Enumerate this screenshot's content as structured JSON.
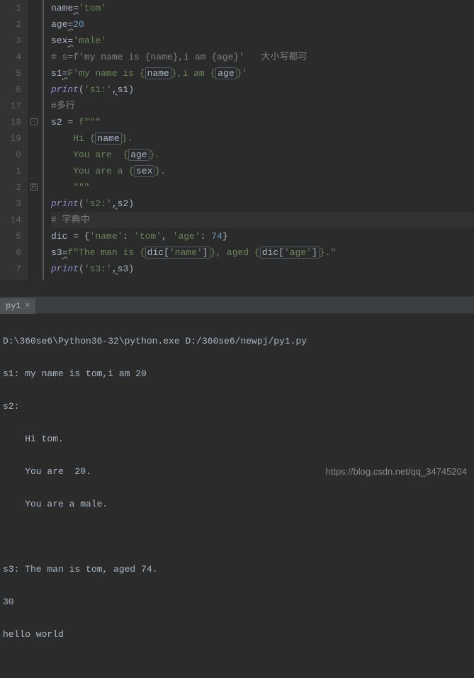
{
  "gutter": [
    "1",
    "2",
    "3",
    "4",
    "5",
    "6",
    "17",
    "18",
    "19",
    "0",
    "1",
    "2",
    "3",
    "14",
    "5",
    "6",
    "7"
  ],
  "code": {
    "l1": {
      "a": "name",
      "b": "=",
      "c": "'tom'"
    },
    "l2": {
      "a": "age",
      "b": "=",
      "c": "20"
    },
    "l3": {
      "a": "sex",
      "b": "=",
      "c": "'male'"
    },
    "l4": "# s=f'my name is {name},i am {age}'   大小写都可",
    "l5": {
      "a": "s1",
      "b": "=",
      "c": "F",
      "d": "'my name is {",
      "v1": "name",
      "e": "},i am {",
      "v2": "age",
      "f": "}'"
    },
    "l6": {
      "fn": "print",
      "a": "(",
      "s": "'s1:'",
      "c": ",",
      "v": "s1",
      "b": ")"
    },
    "l7": "#多行",
    "l8": {
      "a": "s2 = ",
      "b": "f",
      "c": "\"\"\""
    },
    "l9": {
      "a": "    Hi {",
      "v1": "name",
      "b": "}."
    },
    "l10": {
      "a": "    You are  {",
      "v1": "age",
      "b": "}."
    },
    "l11": {
      "a": "    You are a {",
      "v1": "sex",
      "b": "}."
    },
    "l12": "    \"\"\"",
    "l13": {
      "fn": "print",
      "a": "(",
      "s": "'s2:'",
      "c": ",",
      "v": "s2",
      "b": ")"
    },
    "l14": "# 字典中",
    "l15": {
      "a": "dic = {",
      "k1": "'name'",
      "c1": ": ",
      "v1": "'tom'",
      "c2": ", ",
      "k2": "'age'",
      "c3": ": ",
      "v2": "74",
      "b": "}"
    },
    "l16": {
      "a": "s3",
      "b": "=",
      "c": "f",
      "d": "\"The man is {",
      "e": "dic[",
      "k1": "'name'",
      "f": "]",
      "g": "}, aged {",
      "h": "dic[",
      "k2": "'age'",
      "i": "]",
      "j": "}.\""
    },
    "l17": {
      "fn": "print",
      "a": "(",
      "s": "'s3:'",
      "c": ",",
      "v": "s3",
      "b": ")"
    }
  },
  "tab": {
    "label": "py1",
    "close": "×"
  },
  "console": [
    "D:\\360se6\\Python36-32\\python.exe D:/360se6/newpj/py1.py",
    "s1: my name is tom,i am 20",
    "s2: ",
    "    Hi tom.",
    "    You are  20.",
    "    You are a male.",
    "    ",
    "s3: The man is tom, aged 74.",
    "30",
    "hello world"
  ],
  "watermark": "https://blog.csdn.net/qq_34745204"
}
